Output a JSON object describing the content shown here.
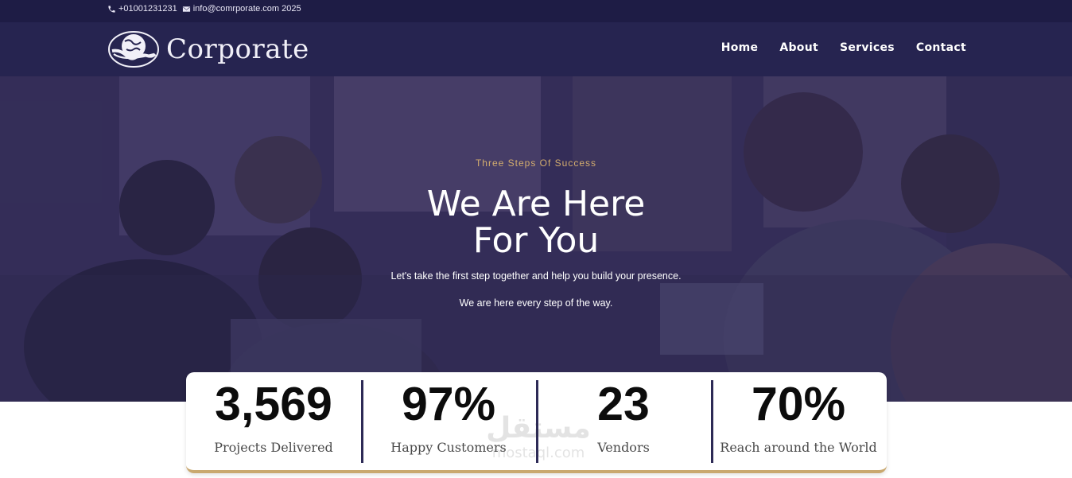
{
  "topbar": {
    "phone": "+01001231231",
    "email": "info@comrporate.com 2025"
  },
  "brand": {
    "name": "Corporate"
  },
  "nav": {
    "items": [
      {
        "label": "Home"
      },
      {
        "label": "About"
      },
      {
        "label": "Services"
      },
      {
        "label": "Contact"
      }
    ]
  },
  "hero": {
    "kicker": "Three Steps Of Success",
    "title_line1": "We Are Here",
    "title_line2": "For You",
    "subtitle1": "Let's take the first step together and help you build your presence.",
    "subtitle2": "We are here every step of the way."
  },
  "stats": [
    {
      "value": "3,569",
      "label": "Projects Delivered"
    },
    {
      "value": "97%",
      "label": "Happy Customers"
    },
    {
      "value": "23",
      "label": "Vendors"
    },
    {
      "value": "70%",
      "label": "Reach around the World"
    }
  ],
  "watermark": {
    "arabic": "مستقل",
    "latin": "mostaql.com"
  },
  "colors": {
    "topbar": "#1e1c45",
    "navbar": "#262450",
    "accent_gold": "#d4ad6e",
    "divider": "#2d2a56"
  }
}
